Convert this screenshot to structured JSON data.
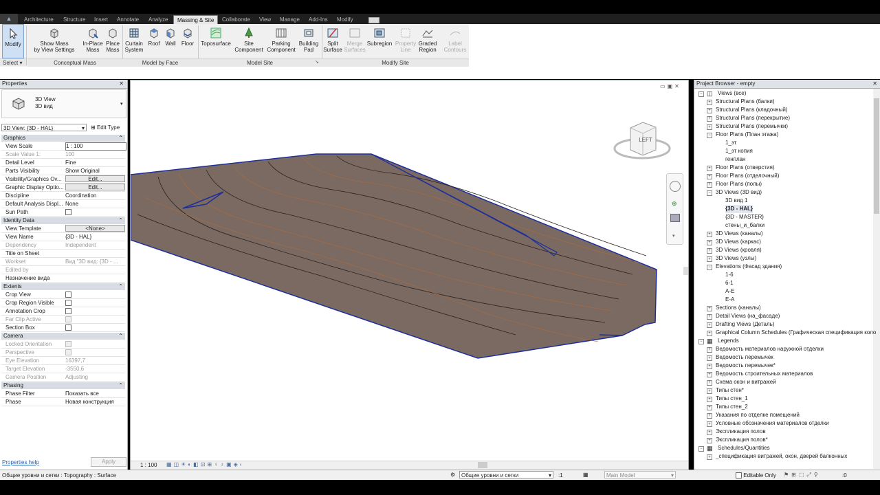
{
  "tabs": [
    "Architecture",
    "Structure",
    "Insert",
    "Annotate",
    "Analyze",
    "Massing & Site",
    "Collaborate",
    "View",
    "Manage",
    "Add-Ins",
    "Modify"
  ],
  "ribbon": {
    "modify": {
      "l1": "Modify",
      "l2": ""
    },
    "select": "Select",
    "groups": [
      "Conceptual Mass",
      "Model by Face",
      "Model Site",
      "Modify Site"
    ],
    "buttons": [
      {
        "l1": "Show Mass",
        "l2": "by View Settings"
      },
      {
        "l1": "In-Place",
        "l2": "Mass"
      },
      {
        "l1": "Place",
        "l2": "Mass"
      },
      {
        "l1": "Curtain",
        "l2": "System"
      },
      {
        "l1": "Roof",
        "l2": ""
      },
      {
        "l1": "Wall",
        "l2": ""
      },
      {
        "l1": "Floor",
        "l2": ""
      },
      {
        "l1": "Toposurface",
        "l2": ""
      },
      {
        "l1": "Site",
        "l2": "Component"
      },
      {
        "l1": "Parking",
        "l2": "Component"
      },
      {
        "l1": "Building",
        "l2": "Pad"
      },
      {
        "l1": "Split",
        "l2": "Surface"
      },
      {
        "l1": "Merge",
        "l2": "Surfaces"
      },
      {
        "l1": "Subregion",
        "l2": ""
      },
      {
        "l1": "Property",
        "l2": "Line"
      },
      {
        "l1": "Graded",
        "l2": "Region"
      },
      {
        "l1": "Label",
        "l2": "Contours"
      }
    ]
  },
  "properties": {
    "title": "Properties",
    "type_name": "3D View",
    "type_sub": "3D вид",
    "selector": "3D View: {3D - HAL}",
    "edit_type": "Edit Type",
    "sections": {
      "graphics": "Graphics",
      "identity": "Identity Data",
      "extents": "Extents",
      "camera": "Camera",
      "phasing": "Phasing"
    },
    "rows": {
      "view_scale": {
        "k": "View Scale",
        "v": "1 : 100"
      },
      "scale_value": {
        "k": "Scale Value    1:",
        "v": "100"
      },
      "detail_level": {
        "k": "Detail Level",
        "v": "Fine"
      },
      "parts_visibility": {
        "k": "Parts Visibility",
        "v": "Show Original"
      },
      "vg_overrides": {
        "k": "Visibility/Graphics Ov...",
        "v": "Edit..."
      },
      "graphic_display": {
        "k": "Graphic Display Optio...",
        "v": "Edit..."
      },
      "discipline": {
        "k": "Discipline",
        "v": "Coordination"
      },
      "analysis_display": {
        "k": "Default Analysis Displ...",
        "v": "None"
      },
      "sun_path": {
        "k": "Sun Path",
        "v": ""
      },
      "view_template": {
        "k": "View Template",
        "v": "<None>"
      },
      "view_name": {
        "k": "View Name",
        "v": "{3D - HAL}"
      },
      "dependency": {
        "k": "Dependency",
        "v": "Independent"
      },
      "title_on_sheet": {
        "k": "Title on Sheet",
        "v": ""
      },
      "workset": {
        "k": "Workset",
        "v": "Вид \"3D вид: {3D - ..."
      },
      "edited_by": {
        "k": "Edited by",
        "v": ""
      },
      "purpose": {
        "k": "Назначение вида",
        "v": ""
      },
      "crop_view": {
        "k": "Crop View",
        "v": ""
      },
      "crop_region_visible": {
        "k": "Crop Region Visible",
        "v": ""
      },
      "annotation_crop": {
        "k": "Annotation Crop",
        "v": ""
      },
      "far_clip_active": {
        "k": "Far Clip Active",
        "v": ""
      },
      "section_box": {
        "k": "Section Box",
        "v": ""
      },
      "locked_orientation": {
        "k": "Locked Orientation",
        "v": ""
      },
      "perspective": {
        "k": "Perspective",
        "v": ""
      },
      "eye_elevation": {
        "k": "Eye Elevation",
        "v": "16397,7"
      },
      "target_elevation": {
        "k": "Target Elevation",
        "v": "-3550,6"
      },
      "camera_position": {
        "k": "Camera Position",
        "v": "Adjusting"
      },
      "phase_filter": {
        "k": "Phase Filter",
        "v": "Показать все"
      },
      "phase": {
        "k": "Phase",
        "v": "Новая конструкция"
      }
    },
    "help": "Properties help",
    "apply": "Apply"
  },
  "viewport": {
    "viewcube_face": "LEFT",
    "scale": "1 : 100"
  },
  "browser": {
    "title": "Project Browser - empty",
    "items": [
      "Views (все)",
      "Structural Plans (балки)",
      "Structural Plans (кладочный)",
      "Structural Plans (перекрытие)",
      "Structural Plans (перемычки)",
      "Floor Plans (План этажа)",
      "1_эт",
      "1_эт копия",
      "генплан",
      "Floor Plans (отверстия)",
      "Floor Plans (отделочный)",
      "Floor Plans (полы)",
      "3D Views (3D вид)",
      "3D вид 1",
      "{3D - HAL}",
      "{3D - MASTER}",
      "стены_и_балки",
      "3D Views (каналы)",
      "3D Views (каркас)",
      "3D Views (кровля)",
      "3D Views (узлы)",
      "Elevations (Фасад здания)",
      "1-6",
      "6-1",
      "А-Е",
      "Е-А",
      "Sections (каналы)",
      "Detail Views (на_фасаде)",
      "Drafting Views (Деталь)",
      "Graphical Column Schedules (Графическая спецификация коло",
      "Legends",
      "Ведомость материалов наружной отделки",
      "Ведомость перемычек",
      "Ведомость перемычек*",
      "Ведомость строительных материалов",
      "Схема окон и витражей",
      "Типы стен*",
      "Типы стен_1",
      "Типы стен_2",
      "Указания по отделке помещений",
      "Условные обозначения материалов отделки",
      "Экспликация полов",
      "Экспликация полов*",
      "Schedules/Quantities",
      "_спецификация витражей, окон, дверей балконных"
    ]
  },
  "status": {
    "text": "Общие уровни и сетки : Topography : Surface",
    "workset": "Общие уровни и сетки",
    "count": ":1",
    "model": "Main Model",
    "editable": "Editable Only",
    "filter": ":0"
  },
  "colors": {
    "terrain": "#7a6a61",
    "boundary": "#1f2f9a",
    "contour_major": "#2a2220",
    "contour_minor": "#b56a3a"
  }
}
